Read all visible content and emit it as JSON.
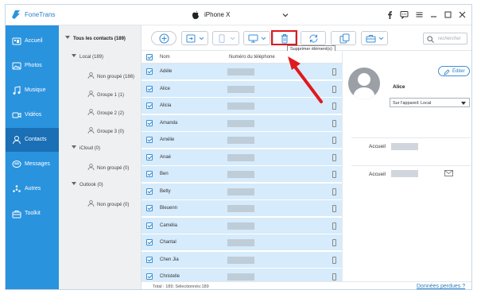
{
  "app": {
    "name": "FoneTrans"
  },
  "device": {
    "name": "iPhone X"
  },
  "titlebar_icons": [
    "facebook-icon",
    "feedback-icon",
    "menu-icon",
    "minimize-icon",
    "maximize-icon",
    "close-icon"
  ],
  "sidebar": {
    "items": [
      {
        "label": "Accueil",
        "icon": "home-icon"
      },
      {
        "label": "Photos",
        "icon": "photos-icon"
      },
      {
        "label": "Musique",
        "icon": "music-icon"
      },
      {
        "label": "Vidéos",
        "icon": "video-icon"
      },
      {
        "label": "Contacts",
        "icon": "contacts-icon",
        "active": true
      },
      {
        "label": "Messages",
        "icon": "messages-icon"
      },
      {
        "label": "Autres",
        "icon": "others-icon"
      },
      {
        "label": "Toolkit",
        "icon": "toolkit-icon"
      }
    ]
  },
  "tree": {
    "all": "Tous les contacts  (189)",
    "local": "Local  (189)",
    "local_children": [
      "Non groupé  (186)",
      "Groupe 1  (1)",
      "Groupe 2  (2)",
      "Groupe 3  (0)"
    ],
    "icloud": "iCloud  (0)",
    "icloud_children": [
      "Non groupé  (0)"
    ],
    "outlook": "Outlook  (0)",
    "outlook_children": [
      "Non groupé  (0)"
    ]
  },
  "toolbar": {
    "tooltip": "Supprimer élément(s)",
    "search_placeholder": "rechercher"
  },
  "list": {
    "col_name": "Nom",
    "col_phone": "Numéro du téléphone",
    "rows": [
      "Adéle",
      "Alice",
      "Alicia",
      "Amanda",
      "Amélie",
      "Anaé",
      "Ben",
      "Betty",
      "Bleuenn",
      "Camélia",
      "Chantal",
      "Chen Jia",
      "Christelle"
    ]
  },
  "status": {
    "summary": "Total : 189; Sélectionnés:189",
    "lost_data": "Données perdues ?"
  },
  "detail": {
    "edit_label": "Éditer",
    "name": "Alice",
    "source": "Sur l'appareil: Local",
    "field1_label": "Accueil",
    "field2_label": "Accueil"
  },
  "colors": {
    "accent": "#2a93de",
    "active": "#1a6fb5",
    "highlight": "#e0191c",
    "row_selected": "#d6ebfb"
  }
}
